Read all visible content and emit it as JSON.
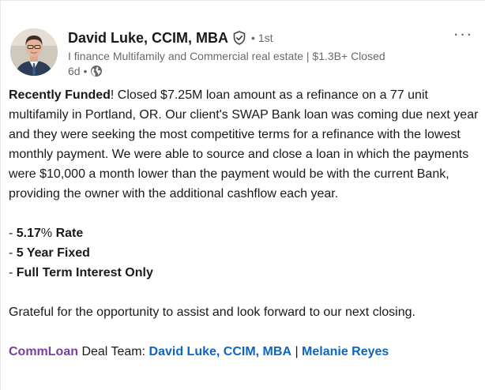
{
  "post": {
    "author": {
      "name": "David Luke, CCIM, MBA",
      "degree": "• 1st",
      "headline": "I finance Multifamily and Commercial real estate | $1.3B+ Closed",
      "time": "6d •"
    },
    "more_label": "···",
    "body": {
      "lead_bold": "Recently Funded",
      "paragraph_rest": "! Closed $7.25M loan amount as a refinance on a 77 unit multifamily in Portland, OR. Our client's SWAP Bank loan was coming due next year and they were seeking the most competitive terms for a refinance with the lowest monthly payment. We were able to source and close a loan in which the payments were $10,000 a month lower than the payment would be with the current Bank, providing the owner with the additional cashflow each year.",
      "bullets": [
        {
          "prefix": "- ",
          "bold": "5.17",
          "rest": "% ",
          "bold2": "Rate"
        },
        {
          "prefix": "- ",
          "bold": "5 Year Fixed"
        },
        {
          "prefix": "- ",
          "bold": "Full Term Interest Only"
        }
      ],
      "closing": "Grateful for the opportunity to assist and look forward to our next closing.",
      "team": {
        "company": "CommLoan",
        "label": " Deal Team: ",
        "member1": "David Luke, CCIM, MBA",
        "separator": " | ",
        "member2": "Melanie Reyes"
      }
    }
  },
  "colors": {
    "link": "#0a66c2",
    "company": "#7b3f9f"
  },
  "icons": {
    "verified": "verified-shield-icon",
    "globe": "globe-icon",
    "more": "more-options-icon"
  }
}
